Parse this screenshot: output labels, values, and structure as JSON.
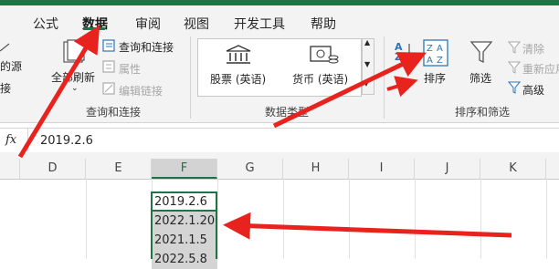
{
  "tabs": [
    {
      "label": "公式"
    },
    {
      "label": "数据"
    },
    {
      "label": "审阅"
    },
    {
      "label": "视图"
    },
    {
      "label": "开发工具"
    },
    {
      "label": "帮助"
    }
  ],
  "ribbon": {
    "partial_left_1": "的源",
    "partial_left_2": "接",
    "refresh_all": "全部刷新",
    "queries_connections": "查询和连接",
    "properties": "属性",
    "edit_links": "编辑链接",
    "group_queries": "查询和连接",
    "stocks": "股票 (英语)",
    "currencies": "货币 (英语)",
    "group_datatypes": "数据类型",
    "sort": "排序",
    "filter": "筛选",
    "clear": "清除",
    "reapply": "重新应用",
    "advanced": "高级",
    "group_sortfilter": "排序和筛选"
  },
  "formula_bar": {
    "fx": "fx",
    "value": "2019.2.6"
  },
  "sheet": {
    "columns": [
      "D",
      "E",
      "F",
      "G",
      "H",
      "I",
      "J",
      "K"
    ],
    "selected_column": "F",
    "cells": [
      "2019.2.6",
      "2022.1.20",
      "2021.1.5",
      "2022.5.8"
    ]
  },
  "colors": {
    "accent_green": "#217346",
    "annotation_red": "#e8231e"
  }
}
